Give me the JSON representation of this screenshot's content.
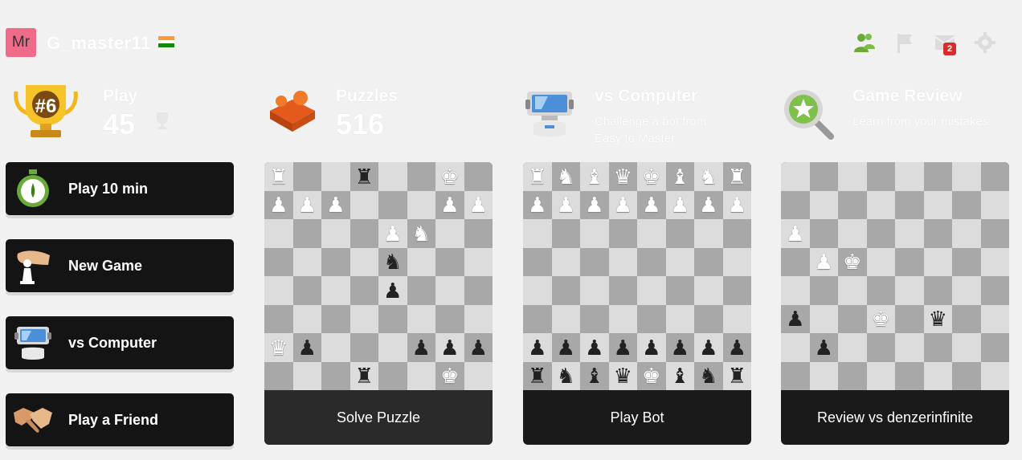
{
  "user": {
    "avatar_text": "Mr",
    "username": "G_master11",
    "flag_colors": [
      "#ff9933",
      "#ffffff",
      "#138808"
    ]
  },
  "top_icons": [
    {
      "name": "friends-icon",
      "color": "#6aaa3a"
    },
    {
      "name": "flag-icon",
      "color": "#dddddd"
    },
    {
      "name": "messages-icon",
      "color": "#dddddd",
      "badge": "2"
    },
    {
      "name": "settings-icon",
      "color": "#dddddd"
    }
  ],
  "play": {
    "title": "Play",
    "trophy_rank": "#6",
    "count": "45"
  },
  "puzzles": {
    "title": "Puzzles",
    "count": "516"
  },
  "vs_computer": {
    "title": "vs Computer",
    "subtitle_line1": "Challenge a bot from",
    "subtitle_line2": "Easy to Master"
  },
  "game_review": {
    "title": "Game Review",
    "subtitle": "Learn from your mistakes"
  },
  "menu": [
    {
      "label": "Play 10 min",
      "icon": "stopwatch-icon"
    },
    {
      "label": "New Game",
      "icon": "hand-pawn-icon"
    },
    {
      "label": "vs Computer",
      "icon": "computer-icon"
    },
    {
      "label": "Play a Friend",
      "icon": "handshake-icon"
    }
  ],
  "cards": [
    {
      "label": "Solve Puzzle",
      "board": [
        [
          "wR",
          "",
          "",
          "bR",
          "",
          "",
          "wK",
          ""
        ],
        [
          "wP",
          "wP",
          "wP",
          "",
          "",
          "",
          "wP",
          "wP"
        ],
        [
          "",
          "",
          "",
          "",
          "wP",
          "wN",
          "",
          ""
        ],
        [
          "",
          "",
          "",
          "",
          "bN",
          "",
          "",
          ""
        ],
        [
          "",
          "",
          "",
          "",
          "bP",
          "",
          "",
          ""
        ],
        [
          "",
          "",
          "",
          "",
          "",
          "",
          "",
          ""
        ],
        [
          "wQ",
          "bP",
          "",
          "",
          "",
          "bP",
          "bP",
          "bP"
        ],
        [
          "",
          "",
          "",
          "bR",
          "",
          "",
          "wK",
          ""
        ]
      ]
    },
    {
      "label": "Play Bot",
      "board": [
        [
          "wR",
          "wN",
          "wB",
          "wQ",
          "wK",
          "wB",
          "wN",
          "wR"
        ],
        [
          "wP",
          "wP",
          "wP",
          "wP",
          "wP",
          "wP",
          "wP",
          "wP"
        ],
        [
          "",
          "",
          "",
          "",
          "",
          "",
          "",
          ""
        ],
        [
          "",
          "",
          "",
          "",
          "",
          "",
          "",
          ""
        ],
        [
          "",
          "",
          "",
          "",
          "",
          "",
          "",
          ""
        ],
        [
          "",
          "",
          "",
          "",
          "",
          "",
          "",
          ""
        ],
        [
          "bP",
          "bP",
          "bP",
          "bP",
          "bP",
          "bP",
          "bP",
          "bP"
        ],
        [
          "bR",
          "bN",
          "bB",
          "bQ",
          "wK",
          "bB",
          "bN",
          "bR"
        ]
      ]
    },
    {
      "label": "Review vs denzerinfinite",
      "board": [
        [
          "",
          "",
          "",
          "",
          "",
          "",
          "",
          ""
        ],
        [
          "",
          "",
          "",
          "",
          "",
          "",
          "",
          ""
        ],
        [
          "wP",
          "",
          "",
          "",
          "",
          "",
          "",
          ""
        ],
        [
          "",
          "wP",
          "wK",
          "",
          "",
          "",
          "",
          ""
        ],
        [
          "",
          "",
          "",
          "",
          "",
          "",
          "",
          ""
        ],
        [
          "bP",
          "",
          "",
          "wK",
          "",
          "bQ",
          "",
          ""
        ],
        [
          "",
          "bP",
          "",
          "",
          "",
          "",
          "",
          ""
        ],
        [
          "",
          "",
          "",
          "",
          "",
          "",
          "",
          ""
        ]
      ]
    }
  ]
}
